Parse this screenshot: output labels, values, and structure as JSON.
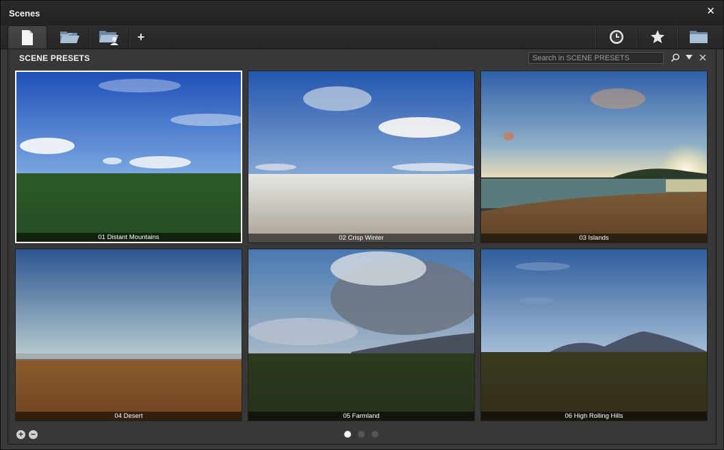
{
  "window": {
    "title": "Scenes",
    "close_icon": "close-icon"
  },
  "tabs": {
    "left": [
      {
        "icon": "new-document-icon",
        "active": true
      },
      {
        "icon": "open-folder-icon",
        "active": false
      },
      {
        "icon": "user-folder-icon",
        "active": false
      }
    ],
    "add_label": "+",
    "right": [
      {
        "icon": "clock-icon"
      },
      {
        "icon": "star-icon"
      },
      {
        "icon": "folder-icon"
      }
    ]
  },
  "panel": {
    "title": "SCENE PRESETS",
    "search_placeholder": "Search in SCENE PRESETS",
    "search_icon": "search-icon",
    "filter_icon": "filter-dropdown-icon",
    "close_icon": "close-panel-icon"
  },
  "presets": [
    {
      "label": "01 Distant Mountains",
      "selected": true
    },
    {
      "label": "02 Crisp Winter",
      "selected": false
    },
    {
      "label": "03 Islands",
      "selected": false
    },
    {
      "label": "04 Desert",
      "selected": false
    },
    {
      "label": "05 Farmland",
      "selected": false
    },
    {
      "label": "06 High Rolling Hills",
      "selected": false
    }
  ],
  "footer": {
    "zoom_in_label": "+",
    "zoom_out_label": "−",
    "pages": 3,
    "current_page": 1
  }
}
